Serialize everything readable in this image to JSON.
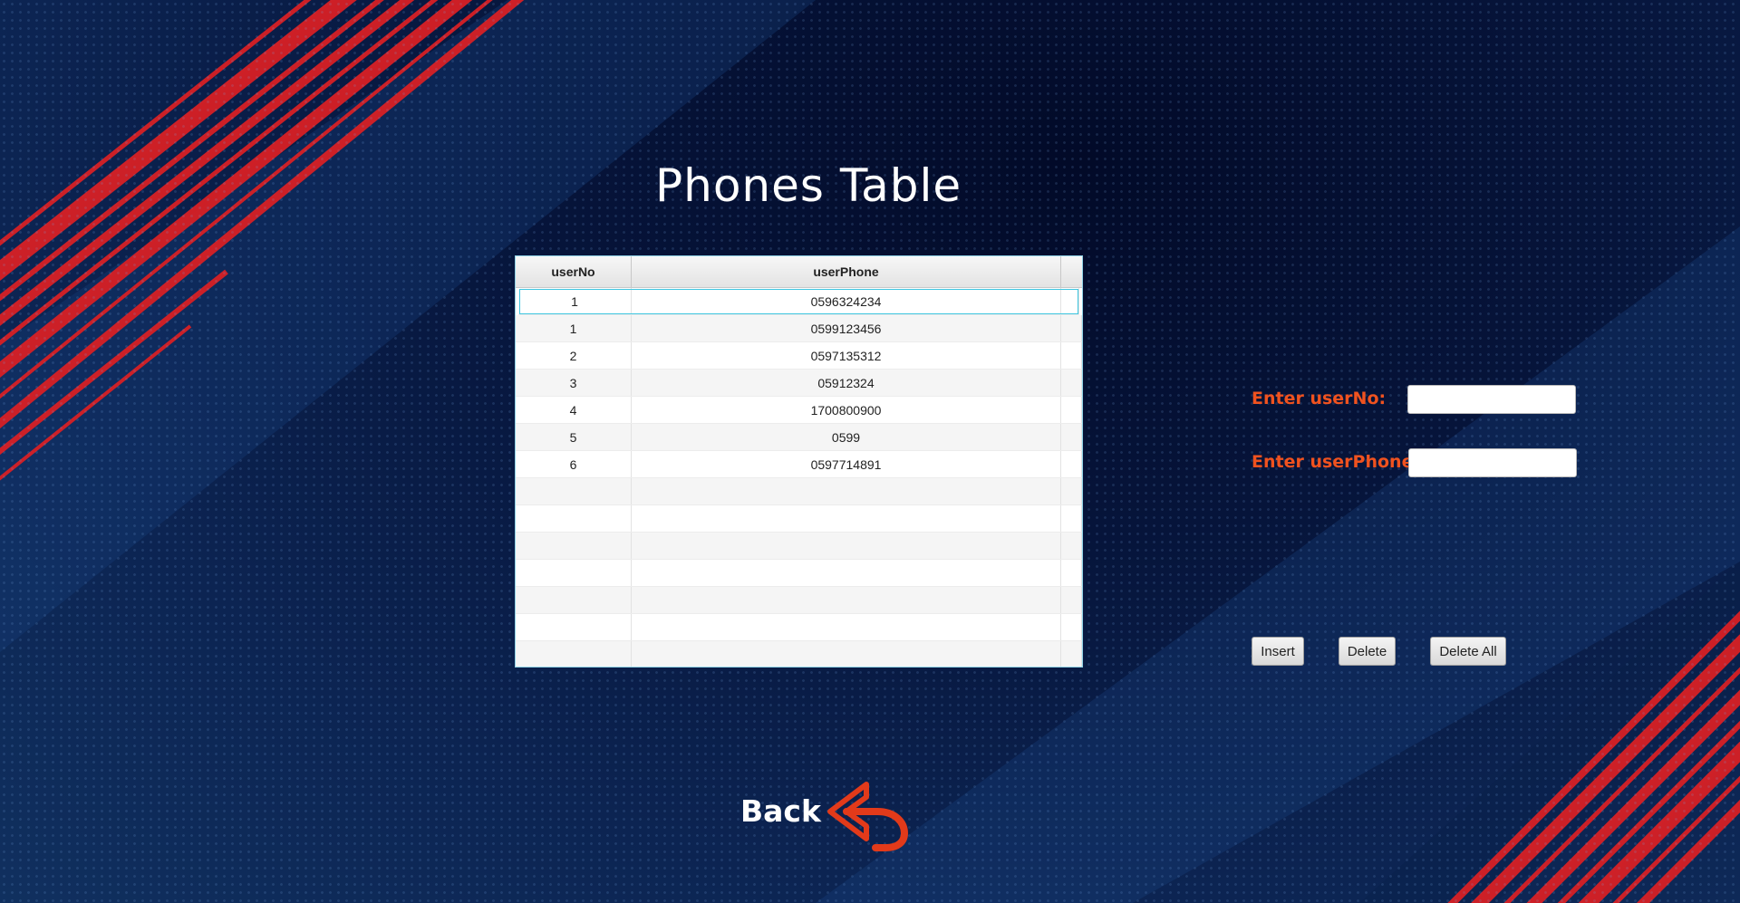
{
  "page": {
    "title": "Phones Table"
  },
  "table": {
    "columns": [
      "userNo",
      "userPhone"
    ],
    "rows": [
      {
        "userNo": "1",
        "userPhone": "0596324234"
      },
      {
        "userNo": "1",
        "userPhone": "0599123456"
      },
      {
        "userNo": "2",
        "userPhone": "0597135312"
      },
      {
        "userNo": "3",
        "userPhone": "05912324"
      },
      {
        "userNo": "4",
        "userPhone": "1700800900"
      },
      {
        "userNo": "5",
        "userPhone": "0599"
      },
      {
        "userNo": "6",
        "userPhone": "0597714891"
      }
    ],
    "selected_row": 0
  },
  "form": {
    "userno_label": "Enter userNo:",
    "userno_value": "",
    "userphone_label": "Enter userPhone:",
    "userphone_value": ""
  },
  "buttons": {
    "insert": "Insert",
    "delete": "Delete",
    "delete_all": "Delete All"
  },
  "nav": {
    "back_label": "Back",
    "back_icon": "return-arrow-icon"
  },
  "colors": {
    "label_orange": "#f0521f",
    "arrow_red": "#e23a1a",
    "selection_cyan": "#3ec6e0"
  }
}
